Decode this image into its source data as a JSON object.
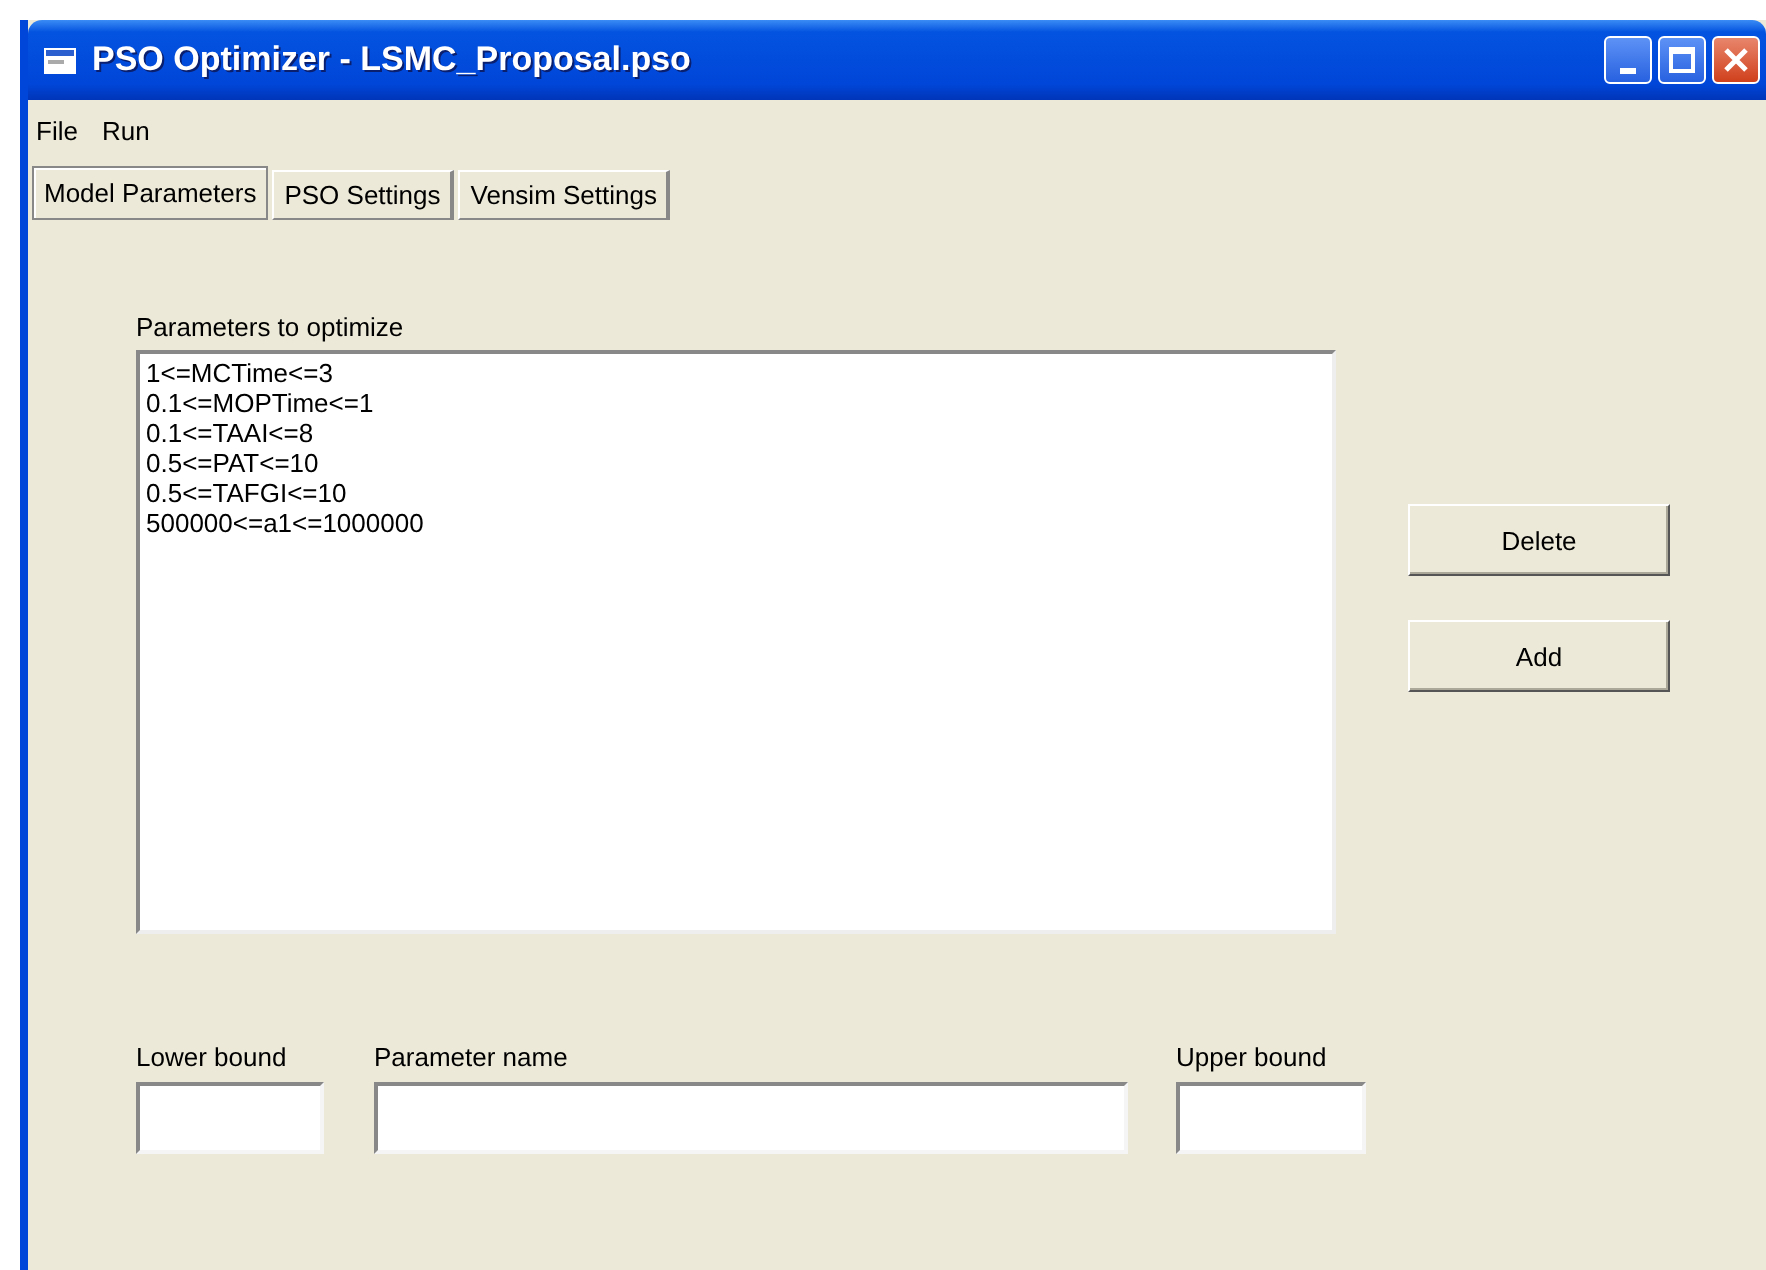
{
  "window": {
    "title": "PSO Optimizer - LSMC_Proposal.pso"
  },
  "menu": [
    "File",
    "Run"
  ],
  "tabs": [
    {
      "label": "Model Parameters",
      "selected": true
    },
    {
      "label": "PSO Settings",
      "selected": false
    },
    {
      "label": "Vensim Settings",
      "selected": false
    }
  ],
  "parameters": {
    "label": "Parameters to optimize",
    "items": [
      "1<=MCTime<=3",
      "0.1<=MOPTime<=1",
      "0.1<=TAAI<=8",
      "0.5<=PAT<=10",
      "0.5<=TAFGI<=10",
      "500000<=a1<=1000000"
    ]
  },
  "buttons": [
    "Delete",
    "Add"
  ],
  "fields": [
    {
      "label": "Lower bound"
    },
    {
      "label": "Parameter name"
    },
    {
      "label": "Upper bound"
    }
  ]
}
